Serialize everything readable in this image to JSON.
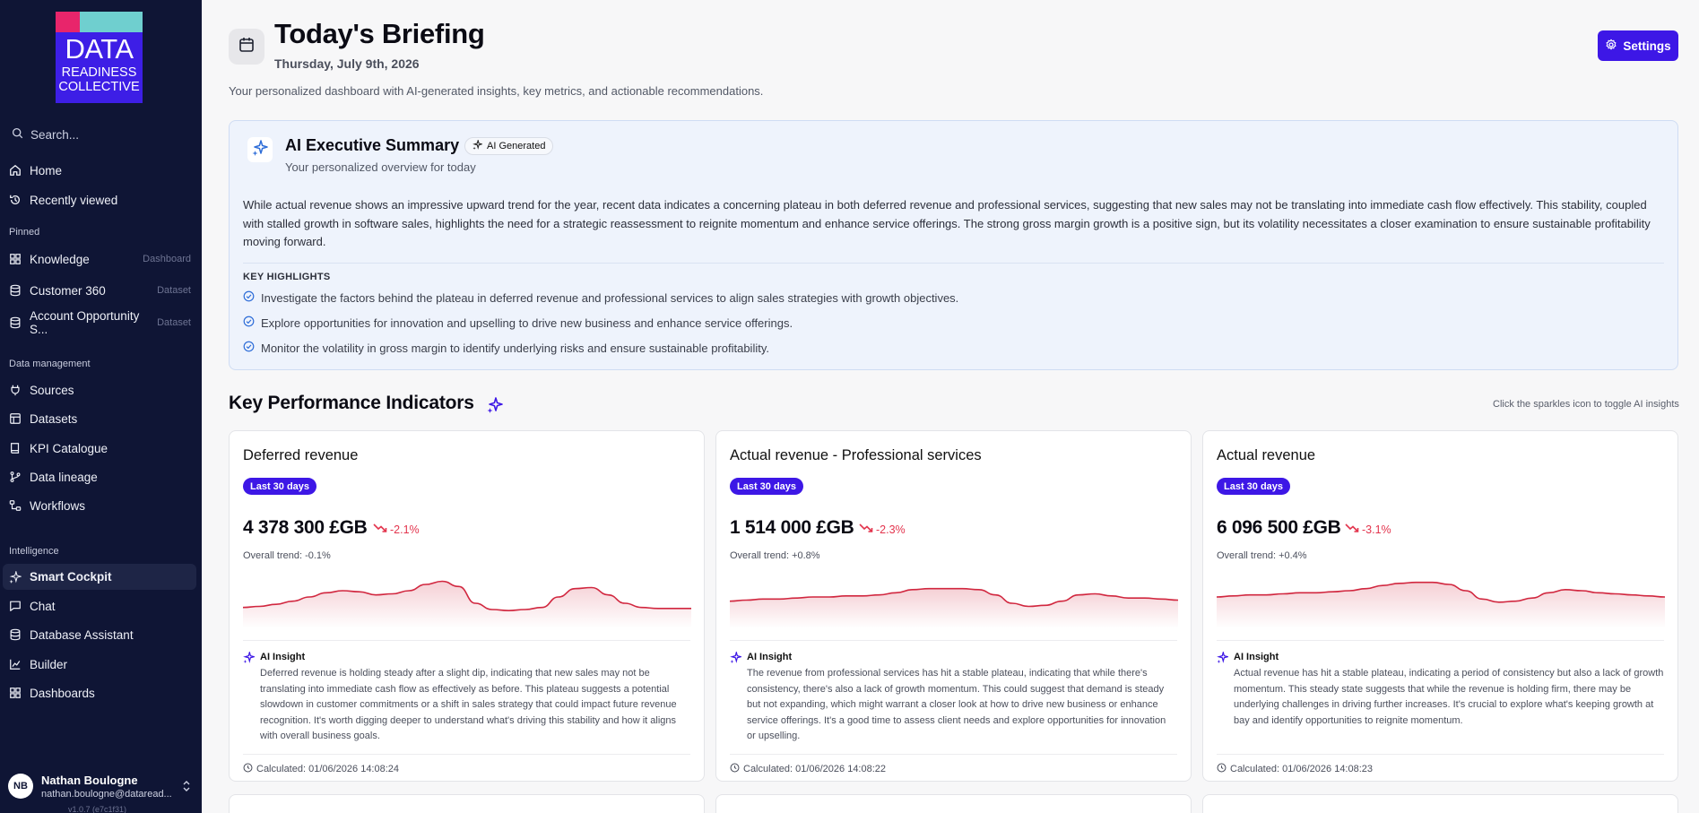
{
  "sidebar": {
    "logo": {
      "line1": "DATA",
      "line2": "READINESS",
      "line3": "COLLECTIVE"
    },
    "search_placeholder": "Search...",
    "top_items": [
      {
        "label": "Home",
        "icon": "home-icon"
      },
      {
        "label": "Recently viewed",
        "icon": "history-icon"
      }
    ],
    "pinned_label": "Pinned",
    "pinned": [
      {
        "label": "Knowledge",
        "tag": "Dashboard"
      },
      {
        "label": "Customer 360",
        "tag": "Dataset"
      },
      {
        "label": "Account Opportunity S...",
        "tag": "Dataset"
      }
    ],
    "data_mgmt_label": "Data management",
    "data_mgmt": [
      {
        "label": "Sources"
      },
      {
        "label": "Datasets"
      },
      {
        "label": "KPI Catalogue"
      },
      {
        "label": "Data lineage"
      },
      {
        "label": "Workflows"
      }
    ],
    "intelligence_label": "Intelligence",
    "intelligence": [
      {
        "label": "Smart Cockpit",
        "active": true
      },
      {
        "label": "Chat"
      },
      {
        "label": "Database Assistant"
      },
      {
        "label": "Builder"
      },
      {
        "label": "Dashboards"
      }
    ],
    "user": {
      "initials": "NB",
      "name": "Nathan Boulogne",
      "email": "nathan.boulogne@dataread..."
    },
    "version": "v1.0.7 (e7c1f31)"
  },
  "header": {
    "title": "Today's Briefing",
    "date": "Thursday, July 9th, 2026",
    "subtitle": "Your personalized dashboard with AI-generated insights, key metrics, and actionable recommendations.",
    "settings_label": "Settings"
  },
  "summary": {
    "title": "AI Executive Summary",
    "badge": "AI Generated",
    "subtitle": "Your personalized overview for today",
    "body": "While actual revenue shows an impressive upward trend for the year, recent data indicates a concerning plateau in both deferred revenue and professional services, suggesting that new sales may not be translating into immediate cash flow effectively. This stability, coupled with stalled growth in software sales, highlights the need for a strategic reassessment to reignite momentum and enhance service offerings. The strong gross margin growth is a positive sign, but its volatility necessitates a closer examination to ensure sustainable profitability moving forward.",
    "highlights_label": "KEY HIGHLIGHTS",
    "highlights": [
      "Investigate the factors behind the plateau in deferred revenue and professional services to align sales strategies with growth objectives.",
      "Explore opportunities for innovation and upselling to drive new business and enhance service offerings.",
      "Monitor the volatility in gross margin to identify underlying risks and ensure sustainable profitability."
    ]
  },
  "kpi": {
    "title": "Key Performance Indicators",
    "hint": "Click the sparkles icon to toggle AI insights",
    "cards": [
      {
        "name": "Deferred revenue",
        "period": "Last 30 days",
        "value": "4 378 300 £GB",
        "change": "-2.1%",
        "trend": "Overall trend: -0.1%",
        "series": [
          50,
          50.5,
          51.5,
          53,
          55,
          57,
          58,
          57.5,
          56,
          56.5,
          58,
          61,
          62.5,
          60,
          52,
          49,
          48.5,
          49,
          50,
          55,
          59,
          59.5,
          56,
          52,
          50,
          49.5,
          49.5,
          49.5
        ],
        "insight_label": "AI Insight",
        "insight": "Deferred revenue is holding steady after a slight dip, indicating that new sales may not be translating into immediate cash flow as effectively as before. This plateau suggests a potential slowdown in customer commitments or a shift in sales strategy that could impact future revenue recognition. It's worth digging deeper to understand what's driving this stability and how it aligns with overall business goals.",
        "calculated": "Calculated: 01/06/2026 14:08:24"
      },
      {
        "name": "Actual revenue - Professional services",
        "period": "Last 30 days",
        "value": "1 514 000 £GB",
        "change": "-2.3%",
        "trend": "Overall trend: +0.8%",
        "series": [
          53,
          53.5,
          54,
          54,
          54.5,
          55,
          55,
          55.5,
          55.5,
          56,
          57,
          58.5,
          59,
          59,
          59,
          58.5,
          56,
          52,
          50.5,
          51,
          53,
          56,
          56.5,
          55.5,
          54.5,
          54.5,
          54,
          53.5
        ],
        "insight_label": "AI Insight",
        "insight": "The revenue from professional services has hit a stable plateau, indicating that while there's consistency, there's also a lack of growth momentum. This could suggest that demand is steady but not expanding, which might warrant a closer look at how to drive new business or enhance service offerings. It's a good time to assess client needs and explore opportunities for innovation or upselling.",
        "calculated": "Calculated: 01/06/2026 14:08:22"
      },
      {
        "name": "Actual revenue",
        "period": "Last 30 days",
        "value": "6 096 500 £GB",
        "change": "-3.1%",
        "trend": "Overall trend: +0.4%",
        "series": [
          55,
          55.5,
          56,
          56,
          56.5,
          57,
          57,
          57.5,
          58,
          59,
          60.5,
          61.5,
          62,
          62,
          61,
          58,
          54,
          52.5,
          53,
          54.5,
          57,
          58.5,
          58,
          57,
          56.5,
          56,
          55.5,
          55
        ],
        "insight_label": "AI Insight",
        "insight": "Actual revenue has hit a stable plateau, indicating a period of consistency but also a lack of growth momentum. This steady state suggests that while the revenue is holding firm, there may be underlying challenges in driving further increases. It's crucial to explore what's keeping growth at bay and identify opportunities to reignite momentum.",
        "calculated": "Calculated: 01/06/2026 14:08:23"
      }
    ]
  },
  "colors": {
    "accent": "#3d17e6",
    "sidebar": "#0f1535",
    "negative": "#e3344d",
    "sparkline": "#d1273f"
  }
}
